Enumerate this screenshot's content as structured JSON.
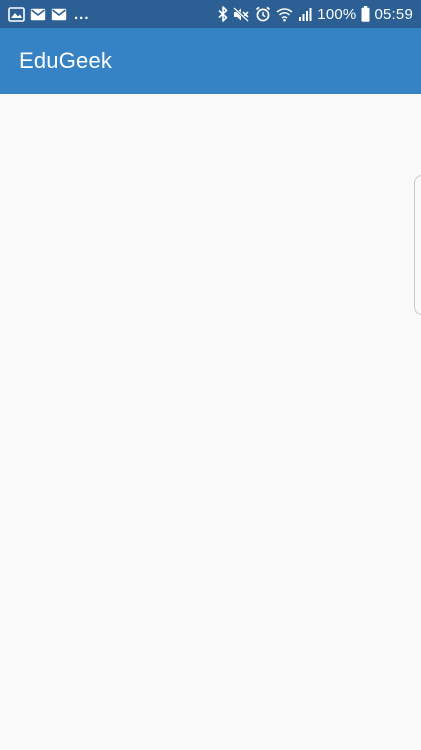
{
  "status_bar": {
    "notifications": [
      "gallery-mail-icon",
      "mail-icon",
      "mail-icon"
    ],
    "more_indicator": "...",
    "system_icons": [
      "bluetooth-icon",
      "mute-icon",
      "alarm-icon",
      "wifi-icon",
      "signal-icon"
    ],
    "battery_percent": "100%",
    "time": "05:59",
    "background_color": "#2c5f93"
  },
  "app_bar": {
    "title": "EduGeek",
    "background_color": "#3582c4"
  },
  "content": {
    "background_color": "#fafafa"
  }
}
